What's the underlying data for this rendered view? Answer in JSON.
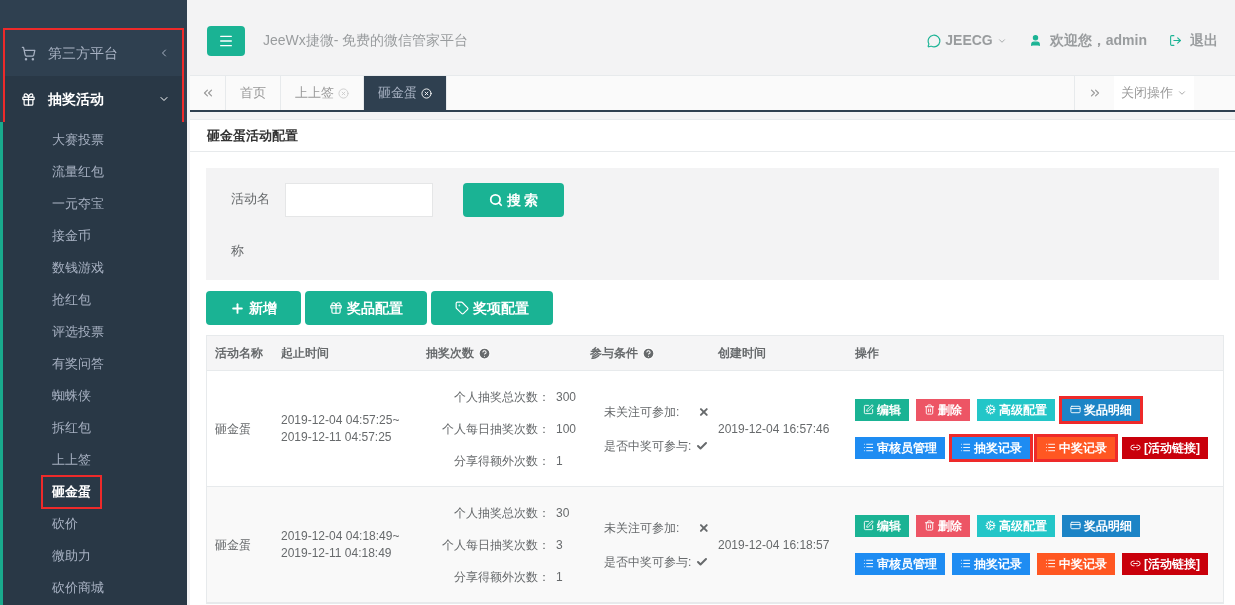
{
  "sidebar": {
    "group": {
      "highlighted": true,
      "items": [
        {
          "label": "第三方平台",
          "kind": "cart",
          "expanded": false
        },
        {
          "label": "抽奖活动",
          "kind": "gift",
          "expanded": true
        }
      ]
    },
    "items": [
      {
        "label": "大赛投票",
        "selected": false,
        "highlighted": false
      },
      {
        "label": "流量红包",
        "selected": false,
        "highlighted": false
      },
      {
        "label": "一元夺宝",
        "selected": false,
        "highlighted": false
      },
      {
        "label": "接金币",
        "selected": false,
        "highlighted": false
      },
      {
        "label": "数钱游戏",
        "selected": false,
        "highlighted": false
      },
      {
        "label": "抢红包",
        "selected": false,
        "highlighted": false
      },
      {
        "label": "评选投票",
        "selected": false,
        "highlighted": false
      },
      {
        "label": "有奖问答",
        "selected": false,
        "highlighted": false
      },
      {
        "label": "蜘蛛侠",
        "selected": false,
        "highlighted": false
      },
      {
        "label": "拆红包",
        "selected": false,
        "highlighted": false
      },
      {
        "label": "上上签",
        "selected": false,
        "highlighted": false
      },
      {
        "label": "砸金蛋",
        "selected": true,
        "highlighted": true
      },
      {
        "label": "砍价",
        "selected": false,
        "highlighted": false
      },
      {
        "label": "微助力",
        "selected": false,
        "highlighted": false
      },
      {
        "label": "砍价商城",
        "selected": false,
        "highlighted": false
      }
    ]
  },
  "header": {
    "title": "JeeWx捷微- 免费的微信管家平台",
    "account": "JEECG",
    "welcome": "欢迎您，admin",
    "logout": "退出"
  },
  "tabs": [
    {
      "label": "首页",
      "selected": false,
      "closable": false
    },
    {
      "label": "上上签",
      "selected": false,
      "closable": true
    },
    {
      "label": "砸金蛋",
      "selected": true,
      "closable": true
    }
  ],
  "close_menu": "关闭操作",
  "panel": {
    "title": "砸金蛋活动配置",
    "search": {
      "label": "活动名称",
      "button": "搜 索"
    },
    "toolbar": [
      {
        "label": "新增",
        "kind": "plus"
      },
      {
        "label": "奖品配置",
        "kind": "gifts"
      },
      {
        "label": "奖项配置",
        "kind": "tag"
      }
    ],
    "table": {
      "columns": [
        {
          "label": "活动名称",
          "help": false
        },
        {
          "label": "起止时间",
          "help": false
        },
        {
          "label": "抽奖次数",
          "help": true
        },
        {
          "label": "参与条件",
          "help": true
        },
        {
          "label": "创建时间",
          "help": false
        },
        {
          "label": "操作",
          "help": false
        }
      ],
      "rows": [
        {
          "name": "砸金蛋",
          "start": "2019-12-04 04:57:25~",
          "end": "2019-12-11 04:57:25",
          "counts": [
            {
              "label": "个人抽奖总次数：",
              "value": "300"
            },
            {
              "label": "个人每日抽奖次数：",
              "value": "100"
            },
            {
              "label": "分享得额外次数：",
              "value": "1"
            }
          ],
          "conditions": [
            {
              "label": "未关注可参加:",
              "checked": false
            },
            {
              "label": "是否中奖可参与:",
              "checked": true
            }
          ],
          "created": "2019-12-04 16:57:46",
          "actions": [
            {
              "label": "编辑",
              "kind": "edit",
              "color": "#1ab394",
              "highlighted": false
            },
            {
              "label": "删除",
              "kind": "trash",
              "color": "#ed5565",
              "highlighted": false
            },
            {
              "label": "高级配置",
              "kind": "gears",
              "color": "#23c6c8",
              "highlighted": false
            },
            {
              "label": "奖品明细",
              "kind": "card",
              "color": "#1c84c6",
              "highlighted": true
            },
            {
              "label": "审核员管理",
              "kind": "list",
              "color": "#1e8cf2",
              "highlighted": false
            },
            {
              "label": "抽奖记录",
              "kind": "list",
              "color": "#1e8cf2",
              "highlighted": true
            },
            {
              "label": "中奖记录",
              "kind": "list",
              "color": "#ff5722",
              "highlighted": true
            },
            {
              "label": "[活动链接]",
              "kind": "link",
              "color": "#c9000b",
              "highlighted": false
            }
          ]
        },
        {
          "name": "砸金蛋",
          "start": "2019-12-04 04:18:49~",
          "end": "2019-12-11 04:18:49",
          "counts": [
            {
              "label": "个人抽奖总次数：",
              "value": "30"
            },
            {
              "label": "个人每日抽奖次数：",
              "value": "3"
            },
            {
              "label": "分享得额外次数：",
              "value": "1"
            }
          ],
          "conditions": [
            {
              "label": "未关注可参加:",
              "checked": false
            },
            {
              "label": "是否中奖可参与:",
              "checked": true
            }
          ],
          "created": "2019-12-04 16:18:57",
          "actions": [
            {
              "label": "编辑",
              "kind": "edit",
              "color": "#1ab394",
              "highlighted": false
            },
            {
              "label": "删除",
              "kind": "trash",
              "color": "#ed5565",
              "highlighted": false
            },
            {
              "label": "高级配置",
              "kind": "gears",
              "color": "#23c6c8",
              "highlighted": false
            },
            {
              "label": "奖品明细",
              "kind": "card",
              "color": "#1c84c6",
              "highlighted": false
            },
            {
              "label": "审核员管理",
              "kind": "list",
              "color": "#1e8cf2",
              "highlighted": false
            },
            {
              "label": "抽奖记录",
              "kind": "list",
              "color": "#1e8cf2",
              "highlighted": false
            },
            {
              "label": "中奖记录",
              "kind": "list",
              "color": "#ff5722",
              "highlighted": false
            },
            {
              "label": "[活动链接]",
              "kind": "link",
              "color": "#c9000b",
              "highlighted": false
            }
          ]
        }
      ]
    }
  }
}
